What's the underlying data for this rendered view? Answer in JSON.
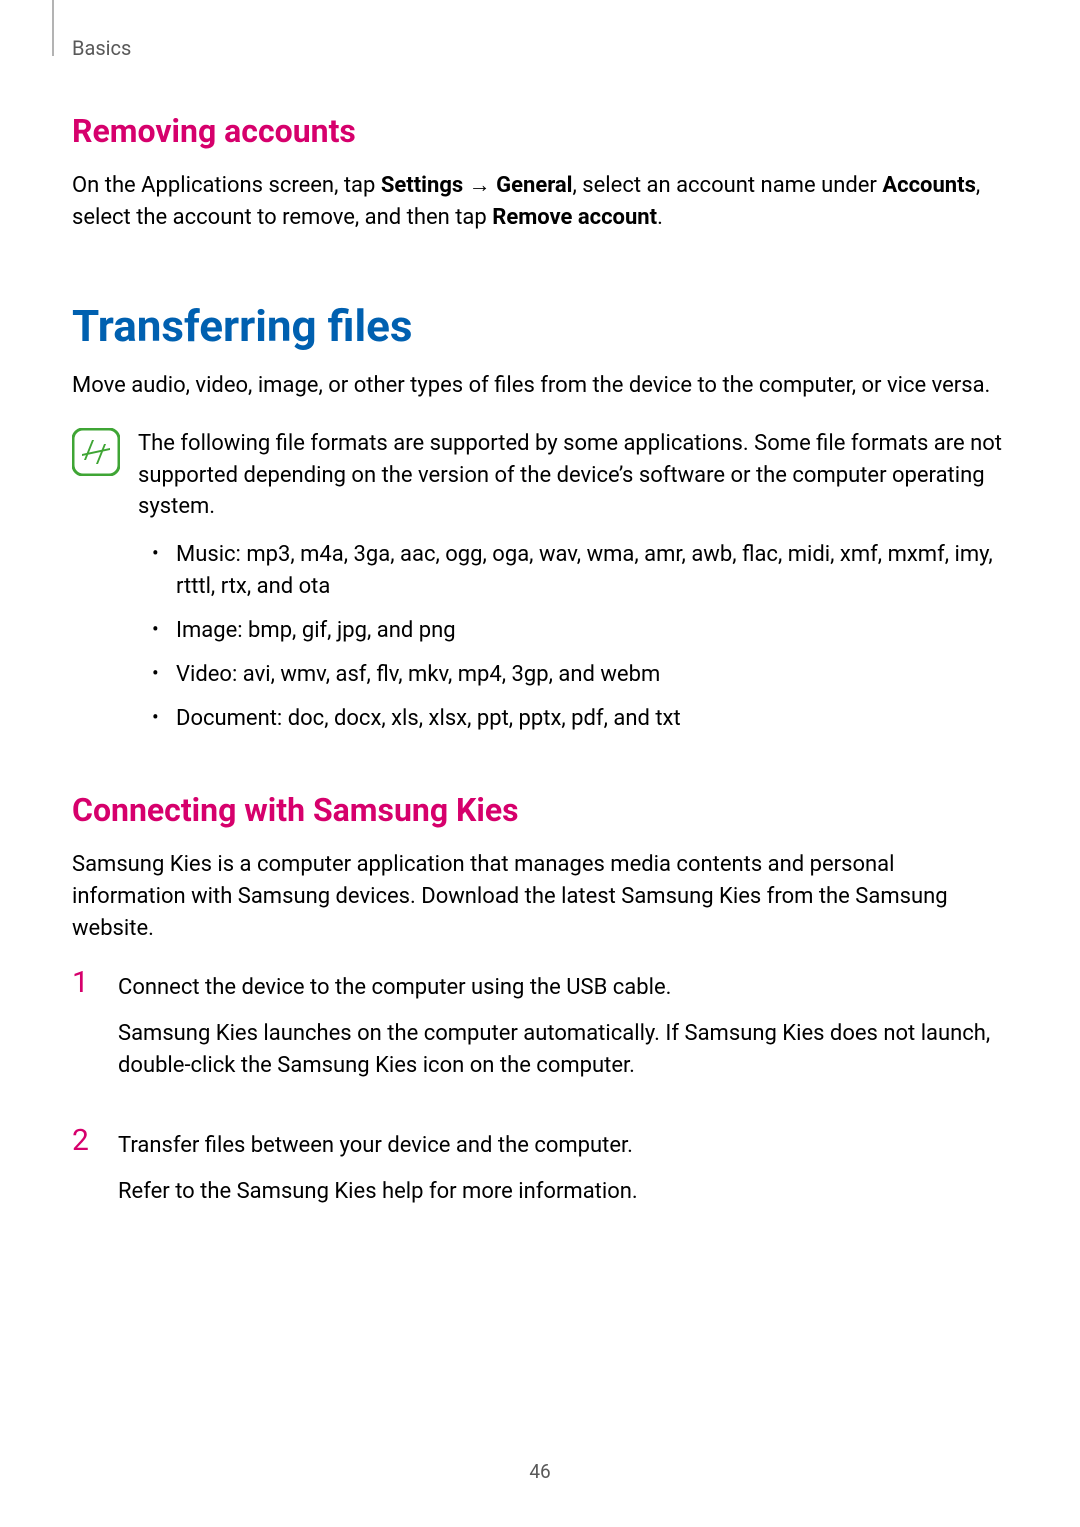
{
  "header": {
    "breadcrumb": "Basics"
  },
  "removing": {
    "heading": "Removing accounts",
    "para_lead": "On the Applications screen, tap ",
    "settings": "Settings",
    "arrow": " → ",
    "general": "General",
    "after_general": ", select an account name under ",
    "accounts": "Accounts",
    "after_accounts": ", select the account to remove, and then tap ",
    "remove_account": "Remove account",
    "period": "."
  },
  "transferring": {
    "heading": "Transferring files",
    "intro": "Move audio, video, image, or other types of files from the device to the computer, or vice versa.",
    "note": "The following file formats are supported by some applications. Some file formats are not supported depending on the version of the device’s software or the computer operating system.",
    "bullets": [
      "Music: mp3, m4a, 3ga, aac, ogg, oga, wav, wma, amr, awb, flac, midi, xmf, mxmf, imy, rtttl, rtx, and ota",
      "Image: bmp, gif, jpg, and png",
      "Video: avi, wmv, asf, flv, mkv, mp4, 3gp, and webm",
      "Document: doc, docx, xls, xlsx, ppt, pptx, pdf, and txt"
    ]
  },
  "kies": {
    "heading": "Connecting with Samsung Kies",
    "intro": "Samsung Kies is a computer application that manages media contents and personal information with Samsung devices. Download the latest Samsung Kies from the Samsung website.",
    "steps": [
      {
        "num": "1",
        "line1": "Connect the device to the computer using the USB cable.",
        "line2": "Samsung Kies launches on the computer automatically. If Samsung Kies does not launch, double-click the Samsung Kies icon on the computer."
      },
      {
        "num": "2",
        "line1": "Transfer files between your device and the computer.",
        "line2": "Refer to the Samsung Kies help for more information."
      }
    ]
  },
  "page_number": "46"
}
